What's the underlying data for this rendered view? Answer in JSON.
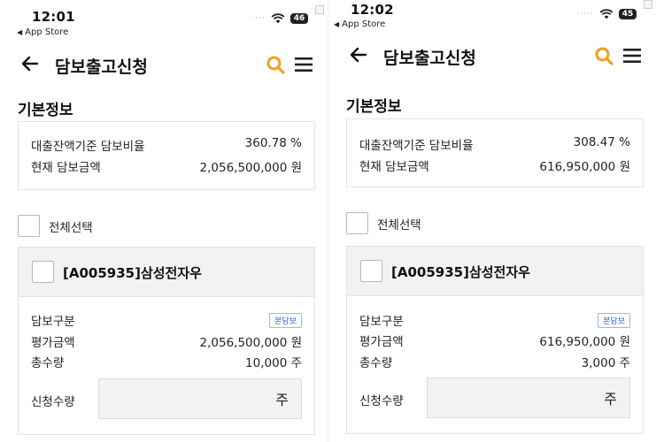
{
  "screens": [
    {
      "status": {
        "time": "12:01",
        "back_app": "App Store",
        "battery": "46"
      },
      "nav": {
        "title": "담보출고신청"
      },
      "section_title": "기본정보",
      "info": {
        "ratio_label": "대출잔액기준 담보비율",
        "ratio_value": "360.78 %",
        "amount_label": "현재 담보금액",
        "amount_value": "2,056,500,000 원"
      },
      "select_all_label": "전체선택",
      "item": {
        "name": "[A005935]삼성전자우",
        "type_label": "담보구분",
        "type_badge": "본담보",
        "eval_label": "평가금액",
        "eval_value": "2,056,500,000 원",
        "total_label": "총수량",
        "total_value": "10,000 주",
        "request_label": "신청수량",
        "request_unit": "주"
      }
    },
    {
      "status": {
        "time": "12:02",
        "back_app": "App Store",
        "battery": "45"
      },
      "nav": {
        "title": "담보출고신청"
      },
      "section_title": "기본정보",
      "info": {
        "ratio_label": "대출잔액기준 담보비율",
        "ratio_value": "308.47 %",
        "amount_label": "현재 담보금액",
        "amount_value": "616,950,000 원"
      },
      "select_all_label": "전체선택",
      "item": {
        "name": "[A005935]삼성전자우",
        "type_label": "담보구분",
        "type_badge": "본담보",
        "eval_label": "평가금액",
        "eval_value": "616,950,000 원",
        "total_label": "총수량",
        "total_value": "3,000 주",
        "request_label": "신청수량",
        "request_unit": "주"
      }
    }
  ],
  "colors": {
    "accent_search": "#f0a020",
    "badge_blue": "#2f66d0"
  },
  "icons": [
    "back-arrow-icon",
    "search-icon",
    "menu-icon",
    "wifi-icon",
    "battery-icon"
  ]
}
